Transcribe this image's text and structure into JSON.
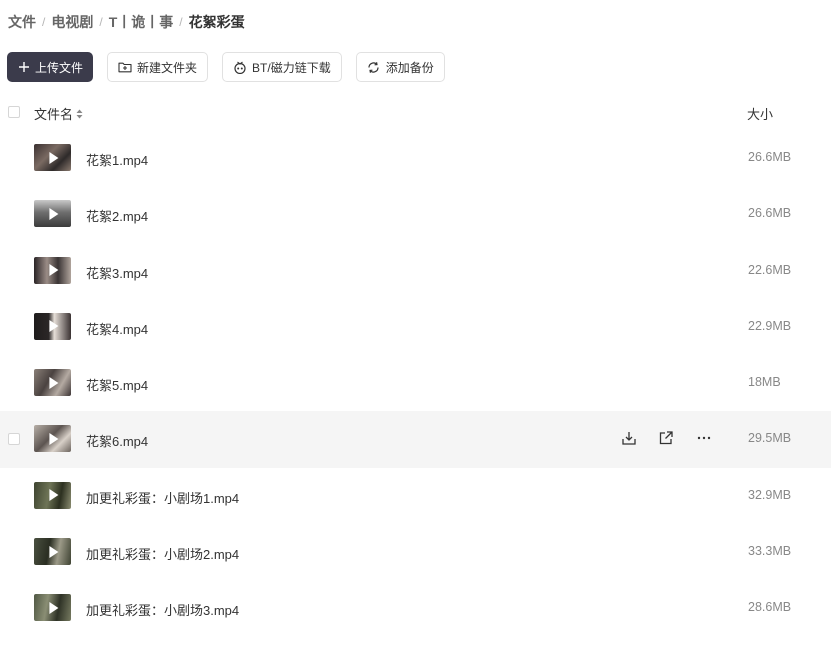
{
  "breadcrumb": [
    "文件",
    "电视剧",
    "T丨诡丨事",
    "花絮彩蛋"
  ],
  "breadcrumb_separator": "/",
  "toolbar": {
    "upload_label": "上传文件",
    "new_folder_label": "新建文件夹",
    "bt_label": "BT/磁力链下载",
    "backup_label": "添加备份"
  },
  "list_header": {
    "name": "文件名",
    "size": "大小"
  },
  "files": [
    {
      "name": "花絮1.mp4",
      "size": "26.6MB"
    },
    {
      "name": "花絮2.mp4",
      "size": "26.6MB"
    },
    {
      "name": "花絮3.mp4",
      "size": "22.6MB"
    },
    {
      "name": "花絮4.mp4",
      "size": "22.9MB"
    },
    {
      "name": "花絮5.mp4",
      "size": "18MB"
    },
    {
      "name": "花絮6.mp4",
      "size": "29.5MB"
    },
    {
      "name": "加更礼彩蛋：小剧场1.mp4",
      "size": "32.9MB"
    },
    {
      "name": "加更礼彩蛋：小剧场2.mp4",
      "size": "33.3MB"
    },
    {
      "name": "加更礼彩蛋：小剧场3.mp4",
      "size": "28.6MB"
    }
  ],
  "hovered_row_index": 5,
  "row_actions": [
    "download-icon",
    "share-icon",
    "more-icon"
  ],
  "colors": {
    "primary_button": "#3b3b4b",
    "row_hover": "#f5f5f5",
    "size_text": "#888888"
  }
}
